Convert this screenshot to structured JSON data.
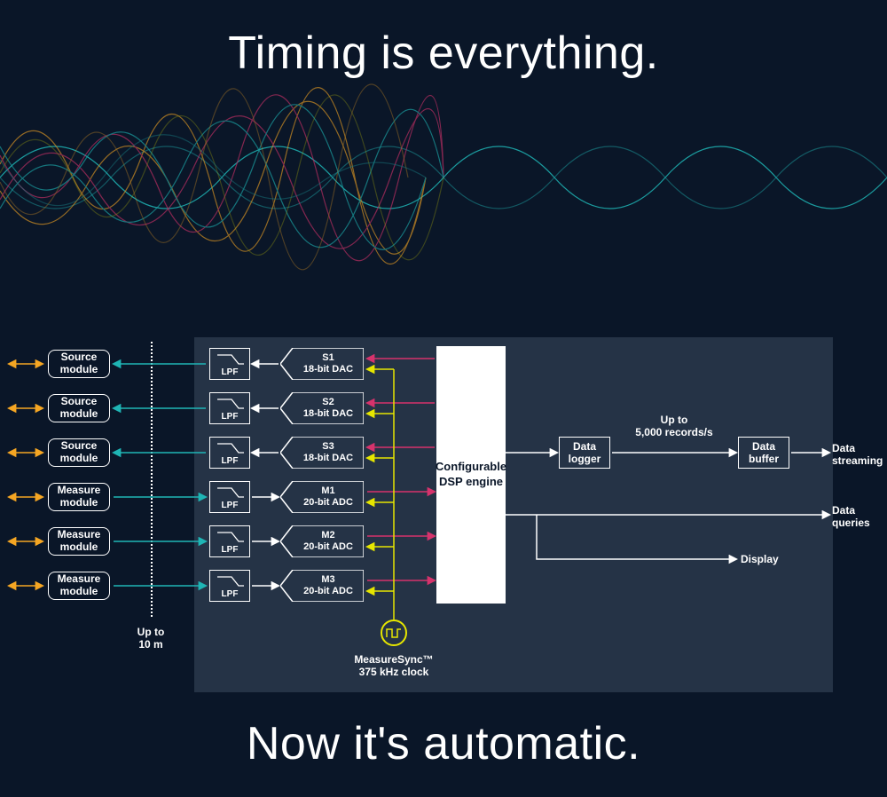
{
  "headline_top": "Timing is everything.",
  "headline_bottom": "Now it's automatic.",
  "modules": {
    "source": [
      "Source\nmodule",
      "Source\nmodule",
      "Source\nmodule"
    ],
    "measure": [
      "Measure\nmodule",
      "Measure\nmodule",
      "Measure\nmodule"
    ]
  },
  "lpf_label": "LPF",
  "dac": [
    {
      "id": "S1",
      "desc": "18-bit DAC"
    },
    {
      "id": "S2",
      "desc": "18-bit DAC"
    },
    {
      "id": "S3",
      "desc": "18-bit DAC"
    }
  ],
  "adc": [
    {
      "id": "M1",
      "desc": "20-bit ADC"
    },
    {
      "id": "M2",
      "desc": "20-bit ADC"
    },
    {
      "id": "M3",
      "desc": "20-bit ADC"
    }
  ],
  "dsp_core": "Configurable\nDSP engine",
  "data_logger": "Data\nlogger",
  "data_buffer": "Data\nbuffer",
  "records_label": "Up to\n5,000 records/s",
  "outputs": {
    "streaming": "Data\nstreaming",
    "queries": "Data\nqueries",
    "display": "Display"
  },
  "clock_label": "MeasureSync™\n375 kHz clock",
  "distance_label": "Up to\n10 m",
  "colors": {
    "bg": "#0a1628",
    "panel": "rgba(120,140,160,0.25)",
    "teal": "#1fb5b5",
    "yellow": "#e6e600",
    "orange": "#f5a623",
    "magenta": "#d6336c",
    "white": "#ffffff"
  }
}
